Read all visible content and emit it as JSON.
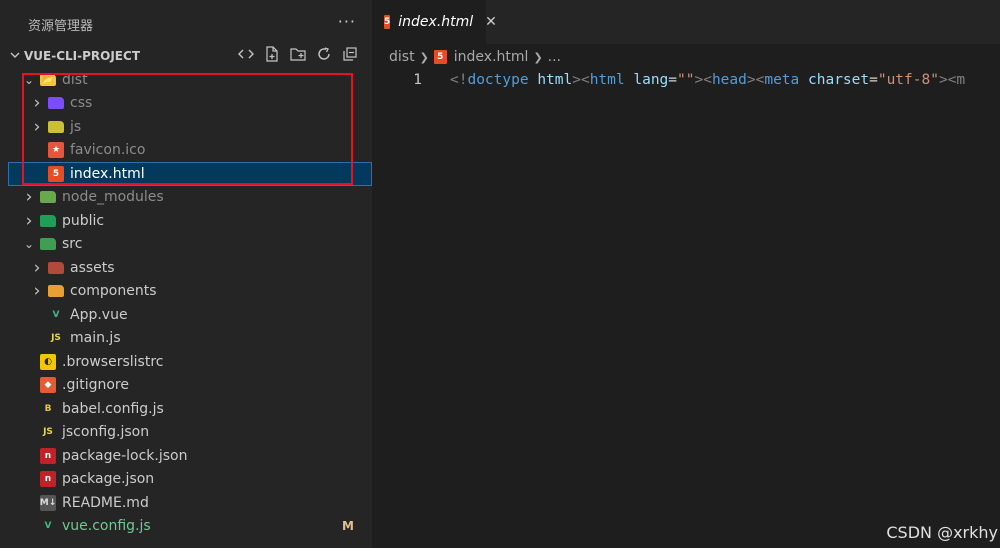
{
  "sidebar": {
    "title": "资源管理器",
    "more_icon": "···",
    "project_name": "VUE-CLI-PROJECT",
    "action_icons": [
      "split-view-icon",
      "new-file-icon",
      "new-folder-icon",
      "refresh-icon",
      "collapse-all-icon"
    ]
  },
  "tree": [
    {
      "label": "dist",
      "icon": "folder-dist-icon",
      "expanded": true,
      "depth": 0,
      "dim": true
    },
    {
      "label": "css",
      "icon": "folder-css-icon",
      "expanded": false,
      "depth": 1,
      "dim": true
    },
    {
      "label": "js",
      "icon": "folder-js-icon",
      "expanded": false,
      "depth": 1,
      "dim": true
    },
    {
      "label": "favicon.ico",
      "icon": "favicon-icon",
      "depth": 1,
      "dim": true
    },
    {
      "label": "index.html",
      "icon": "html5-icon",
      "depth": 1,
      "selected": true
    },
    {
      "label": "node_modules",
      "icon": "folder-node-icon",
      "expanded": false,
      "depth": 0,
      "dim": true
    },
    {
      "label": "public",
      "icon": "folder-public-icon",
      "expanded": false,
      "depth": 0
    },
    {
      "label": "src",
      "icon": "folder-src-icon",
      "expanded": true,
      "depth": 0
    },
    {
      "label": "assets",
      "icon": "folder-assets-icon",
      "expanded": false,
      "depth": 1
    },
    {
      "label": "components",
      "icon": "folder-components-icon",
      "expanded": false,
      "depth": 1
    },
    {
      "label": "App.vue",
      "icon": "vue-icon",
      "depth": 1
    },
    {
      "label": "main.js",
      "icon": "js-icon",
      "depth": 1
    },
    {
      "label": ".browserslistrc",
      "icon": "browserslist-icon",
      "depth": 0
    },
    {
      "label": ".gitignore",
      "icon": "git-icon",
      "depth": 0
    },
    {
      "label": "babel.config.js",
      "icon": "babel-icon",
      "depth": 0
    },
    {
      "label": "jsconfig.json",
      "icon": "js-icon",
      "depth": 0
    },
    {
      "label": "package-lock.json",
      "icon": "npm-icon",
      "depth": 0
    },
    {
      "label": "package.json",
      "icon": "npm-icon",
      "depth": 0
    },
    {
      "label": "README.md",
      "icon": "markdown-icon",
      "depth": 0
    },
    {
      "label": "vue.config.js",
      "icon": "vue-config-icon",
      "depth": 0,
      "modified": true,
      "badge": "M"
    }
  ],
  "editor": {
    "tab_label": "index.html",
    "tab_close": "✕",
    "breadcrumb": [
      "dist",
      "index.html",
      "..."
    ],
    "line_number": "1",
    "code_tokens": [
      {
        "t": "<!",
        "c": "tg"
      },
      {
        "t": "doctype",
        "c": "tn"
      },
      {
        "t": " ",
        "c": "pl"
      },
      {
        "t": "html",
        "c": "at"
      },
      {
        "t": ">",
        "c": "tg"
      },
      {
        "t": "<",
        "c": "tg"
      },
      {
        "t": "html",
        "c": "tn"
      },
      {
        "t": " ",
        "c": "pl"
      },
      {
        "t": "lang",
        "c": "at"
      },
      {
        "t": "=",
        "c": "pl"
      },
      {
        "t": "\"\"",
        "c": "st"
      },
      {
        "t": ">",
        "c": "tg"
      },
      {
        "t": "<",
        "c": "tg"
      },
      {
        "t": "head",
        "c": "tn"
      },
      {
        "t": ">",
        "c": "tg"
      },
      {
        "t": "<",
        "c": "tg"
      },
      {
        "t": "meta",
        "c": "tn"
      },
      {
        "t": " ",
        "c": "pl"
      },
      {
        "t": "charset",
        "c": "at"
      },
      {
        "t": "=",
        "c": "pl"
      },
      {
        "t": "\"utf-8\"",
        "c": "st"
      },
      {
        "t": ">",
        "c": "tg"
      },
      {
        "t": "<m",
        "c": "tg"
      }
    ]
  },
  "watermark": "CSDN @xrkhy",
  "colors": {
    "selection": "#04395e",
    "highlight_box": "#e81123",
    "modified": "#73c991",
    "badge": "#e2c08d"
  }
}
